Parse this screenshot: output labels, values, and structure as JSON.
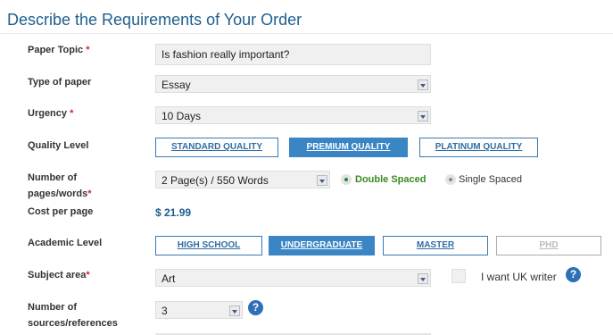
{
  "header": {
    "title": "Describe the Requirements of Your Order"
  },
  "labels": {
    "paper_topic": "Paper Topic",
    "type_of_paper": "Type of paper",
    "urgency": "Urgency",
    "quality_level": "Quality Level",
    "number_of_pages_line1": "Number of",
    "number_of_pages_line2": "pages/words",
    "cost_per_page": "Cost per page",
    "academic_level": "Academic Level",
    "subject_area": "Subject area",
    "sources_line1": "Number of",
    "sources_line2": "sources/references",
    "required_mark": "*"
  },
  "fields": {
    "paper_topic": "Is fashion really important?",
    "type_of_paper": "Essay",
    "urgency": "10 Days",
    "pages": "2 Page(s) / 550 Words",
    "subject_area": "Art",
    "sources": "3"
  },
  "quality_buttons": [
    "STANDARD QUALITY",
    "PREMIUM QUALITY",
    "PLATINUM QUALITY"
  ],
  "quality_selected": "PREMIUM QUALITY",
  "spacing": {
    "double": "Double Spaced",
    "single": "Single Spaced",
    "selected": "Double Spaced"
  },
  "cost_per_page": "$ 21.99",
  "academic_buttons": [
    "HIGH SCHOOL",
    "UNDERGRADUATE",
    "MASTER",
    "PHD"
  ],
  "academic_selected": "UNDERGRADUATE",
  "uk_writer_label": "I want UK writer",
  "help_glyph": "?",
  "colors": {
    "accent": "#3a85c4",
    "title": "#1e5f8f",
    "price": "#1e5f8f",
    "green": "#1f8a36",
    "required": "#d9232e"
  }
}
